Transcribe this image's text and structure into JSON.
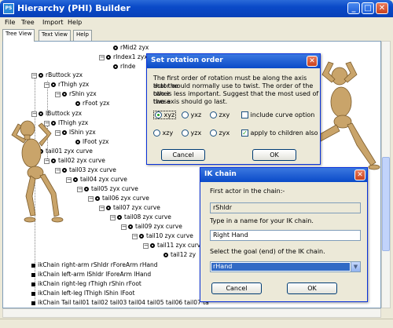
{
  "window": {
    "title": "Hierarchy (PHI) Builder",
    "icon_label": "PS",
    "minimize_glyph": "_",
    "maximize_glyph": "□",
    "close_glyph": "✕"
  },
  "menu": [
    "File",
    "Tree",
    "Import",
    "Help"
  ],
  "tabs": [
    "Tree View",
    "Text View",
    "Help"
  ],
  "tree": [
    {
      "label": "rMid2 zyx",
      "type": "circle"
    },
    {
      "label": "rIndex1 zyx",
      "type": "circle",
      "expand": "−"
    },
    {
      "label": "rInde",
      "type": "circle"
    },
    {
      "label": "rButtock yzx",
      "type": "circle",
      "expand": "−"
    },
    {
      "label": "rThigh yzx",
      "type": "circle",
      "expand": "−"
    },
    {
      "label": "rShin yzx",
      "type": "circle",
      "expand": "−"
    },
    {
      "label": "rFoot yzx",
      "type": "circle"
    },
    {
      "label": "lButtock yzx",
      "type": "circle",
      "expand": "−"
    },
    {
      "label": "lThigh yzx",
      "type": "circle",
      "expand": "−"
    },
    {
      "label": "lShin yzx",
      "type": "circle",
      "expand": "−"
    },
    {
      "label": "lFoot yzx",
      "type": "circle"
    },
    {
      "label": "tail01 zyx curve",
      "type": "circle",
      "expand": "−"
    },
    {
      "label": "tail02 zyx curve",
      "type": "circle",
      "expand": "−"
    },
    {
      "label": "tail03 zyx curve",
      "type": "circle",
      "expand": "−"
    },
    {
      "label": "tail04 zyx curve",
      "type": "circle",
      "expand": "−"
    },
    {
      "label": "tail05 zyx curve",
      "type": "circle",
      "expand": "−"
    },
    {
      "label": "tail06 zyx curve",
      "type": "circle",
      "expand": "−"
    },
    {
      "label": "tail07 zyx curve",
      "type": "circle",
      "expand": "−"
    },
    {
      "label": "tail08 zyx curve",
      "type": "circle",
      "expand": "−"
    },
    {
      "label": "tail09 zyx curve",
      "type": "circle",
      "expand": "−"
    },
    {
      "label": "tail10 zyx curve",
      "type": "circle",
      "expand": "−"
    },
    {
      "label": "tail11 zyx curve",
      "type": "circle",
      "expand": "−"
    },
    {
      "label": "tail12 zy",
      "type": "circle"
    },
    {
      "label": "ikChain right-arm rShldr rForeArm rHand",
      "type": "square"
    },
    {
      "label": "ikChain left-arm lShldr lForeArm lHand",
      "type": "square"
    },
    {
      "label": "ikChain right-leg rThigh rShin rFoot",
      "type": "square"
    },
    {
      "label": "ikChain left-leg lThigh lShin lFoot",
      "type": "square"
    },
    {
      "label": "ikChain Tail tail01 tail02 tail03 tail04 tail05 tail06 tail07 ta",
      "type": "square"
    }
  ],
  "rotation_dialog": {
    "title": "Set rotation order",
    "close_glyph": "✕",
    "text": [
      "The first order of rotation must be along the axis that the",
      "actor would normally use to twist. The order of the other",
      "two is less important. Suggest that the most used of these",
      "two axis should go last."
    ],
    "options_row1": [
      "xyz",
      "yxz",
      "zxy"
    ],
    "options_row2": [
      "xzy",
      "yzx",
      "zyx"
    ],
    "selected": "xyz",
    "checkbox_curve": "include curve option",
    "checkbox_children": "apply to children also",
    "children_checked": true,
    "curve_checked": false,
    "cancel": "Cancel",
    "ok": "OK"
  },
  "ik_dialog": {
    "title": "IK chain",
    "close_glyph": "✕",
    "first_actor_label": "First actor in the chain:-",
    "first_actor_value": "rShldr",
    "name_label": "Type in a name for your IK chain.",
    "name_value": "Right Hand",
    "goal_label": "Select the goal (end) of the IK chain.",
    "goal_value": "rHand",
    "dropdown_glyph": "▼",
    "cancel": "Cancel",
    "ok": "OK"
  }
}
